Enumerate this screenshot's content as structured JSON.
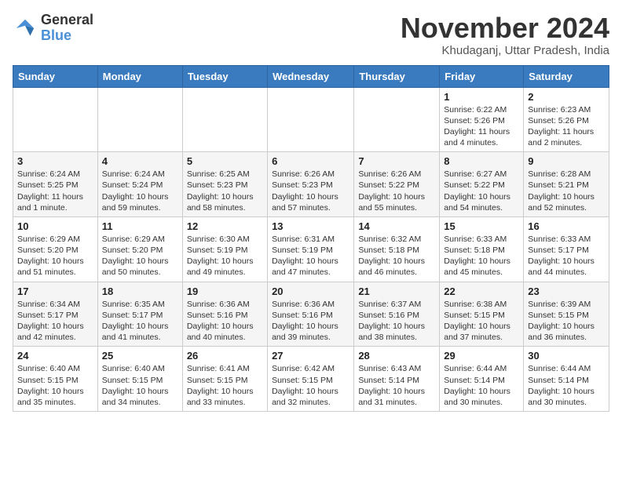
{
  "header": {
    "logo_line1": "General",
    "logo_line2": "Blue",
    "month": "November 2024",
    "location": "Khudaganj, Uttar Pradesh, India"
  },
  "days_of_week": [
    "Sunday",
    "Monday",
    "Tuesday",
    "Wednesday",
    "Thursday",
    "Friday",
    "Saturday"
  ],
  "weeks": [
    [
      {
        "day": "",
        "info": ""
      },
      {
        "day": "",
        "info": ""
      },
      {
        "day": "",
        "info": ""
      },
      {
        "day": "",
        "info": ""
      },
      {
        "day": "",
        "info": ""
      },
      {
        "day": "1",
        "info": "Sunrise: 6:22 AM\nSunset: 5:26 PM\nDaylight: 11 hours and 4 minutes."
      },
      {
        "day": "2",
        "info": "Sunrise: 6:23 AM\nSunset: 5:26 PM\nDaylight: 11 hours and 2 minutes."
      }
    ],
    [
      {
        "day": "3",
        "info": "Sunrise: 6:24 AM\nSunset: 5:25 PM\nDaylight: 11 hours and 1 minute."
      },
      {
        "day": "4",
        "info": "Sunrise: 6:24 AM\nSunset: 5:24 PM\nDaylight: 10 hours and 59 minutes."
      },
      {
        "day": "5",
        "info": "Sunrise: 6:25 AM\nSunset: 5:23 PM\nDaylight: 10 hours and 58 minutes."
      },
      {
        "day": "6",
        "info": "Sunrise: 6:26 AM\nSunset: 5:23 PM\nDaylight: 10 hours and 57 minutes."
      },
      {
        "day": "7",
        "info": "Sunrise: 6:26 AM\nSunset: 5:22 PM\nDaylight: 10 hours and 55 minutes."
      },
      {
        "day": "8",
        "info": "Sunrise: 6:27 AM\nSunset: 5:22 PM\nDaylight: 10 hours and 54 minutes."
      },
      {
        "day": "9",
        "info": "Sunrise: 6:28 AM\nSunset: 5:21 PM\nDaylight: 10 hours and 52 minutes."
      }
    ],
    [
      {
        "day": "10",
        "info": "Sunrise: 6:29 AM\nSunset: 5:20 PM\nDaylight: 10 hours and 51 minutes."
      },
      {
        "day": "11",
        "info": "Sunrise: 6:29 AM\nSunset: 5:20 PM\nDaylight: 10 hours and 50 minutes."
      },
      {
        "day": "12",
        "info": "Sunrise: 6:30 AM\nSunset: 5:19 PM\nDaylight: 10 hours and 49 minutes."
      },
      {
        "day": "13",
        "info": "Sunrise: 6:31 AM\nSunset: 5:19 PM\nDaylight: 10 hours and 47 minutes."
      },
      {
        "day": "14",
        "info": "Sunrise: 6:32 AM\nSunset: 5:18 PM\nDaylight: 10 hours and 46 minutes."
      },
      {
        "day": "15",
        "info": "Sunrise: 6:33 AM\nSunset: 5:18 PM\nDaylight: 10 hours and 45 minutes."
      },
      {
        "day": "16",
        "info": "Sunrise: 6:33 AM\nSunset: 5:17 PM\nDaylight: 10 hours and 44 minutes."
      }
    ],
    [
      {
        "day": "17",
        "info": "Sunrise: 6:34 AM\nSunset: 5:17 PM\nDaylight: 10 hours and 42 minutes."
      },
      {
        "day": "18",
        "info": "Sunrise: 6:35 AM\nSunset: 5:17 PM\nDaylight: 10 hours and 41 minutes."
      },
      {
        "day": "19",
        "info": "Sunrise: 6:36 AM\nSunset: 5:16 PM\nDaylight: 10 hours and 40 minutes."
      },
      {
        "day": "20",
        "info": "Sunrise: 6:36 AM\nSunset: 5:16 PM\nDaylight: 10 hours and 39 minutes."
      },
      {
        "day": "21",
        "info": "Sunrise: 6:37 AM\nSunset: 5:16 PM\nDaylight: 10 hours and 38 minutes."
      },
      {
        "day": "22",
        "info": "Sunrise: 6:38 AM\nSunset: 5:15 PM\nDaylight: 10 hours and 37 minutes."
      },
      {
        "day": "23",
        "info": "Sunrise: 6:39 AM\nSunset: 5:15 PM\nDaylight: 10 hours and 36 minutes."
      }
    ],
    [
      {
        "day": "24",
        "info": "Sunrise: 6:40 AM\nSunset: 5:15 PM\nDaylight: 10 hours and 35 minutes."
      },
      {
        "day": "25",
        "info": "Sunrise: 6:40 AM\nSunset: 5:15 PM\nDaylight: 10 hours and 34 minutes."
      },
      {
        "day": "26",
        "info": "Sunrise: 6:41 AM\nSunset: 5:15 PM\nDaylight: 10 hours and 33 minutes."
      },
      {
        "day": "27",
        "info": "Sunrise: 6:42 AM\nSunset: 5:15 PM\nDaylight: 10 hours and 32 minutes."
      },
      {
        "day": "28",
        "info": "Sunrise: 6:43 AM\nSunset: 5:14 PM\nDaylight: 10 hours and 31 minutes."
      },
      {
        "day": "29",
        "info": "Sunrise: 6:44 AM\nSunset: 5:14 PM\nDaylight: 10 hours and 30 minutes."
      },
      {
        "day": "30",
        "info": "Sunrise: 6:44 AM\nSunset: 5:14 PM\nDaylight: 10 hours and 30 minutes."
      }
    ]
  ]
}
